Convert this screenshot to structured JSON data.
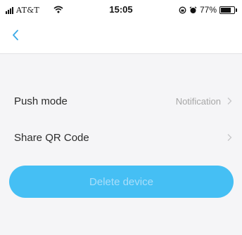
{
  "status_bar": {
    "carrier": "AT&T",
    "time": "15:05",
    "battery_percent": "77%",
    "battery_level": 0.77,
    "icons": [
      "signal-icon",
      "wifi-icon",
      "rotation-lock-icon",
      "alarm-icon",
      "battery-icon"
    ]
  },
  "nav": {
    "back_icon": "chevron-left-icon",
    "accent": "#3aa9e6"
  },
  "settings": {
    "items": [
      {
        "label": "Push mode",
        "value": "Notification"
      },
      {
        "label": "Share QR Code",
        "value": ""
      }
    ]
  },
  "actions": {
    "delete_label": "Delete device",
    "delete_color": "#45bff4"
  }
}
